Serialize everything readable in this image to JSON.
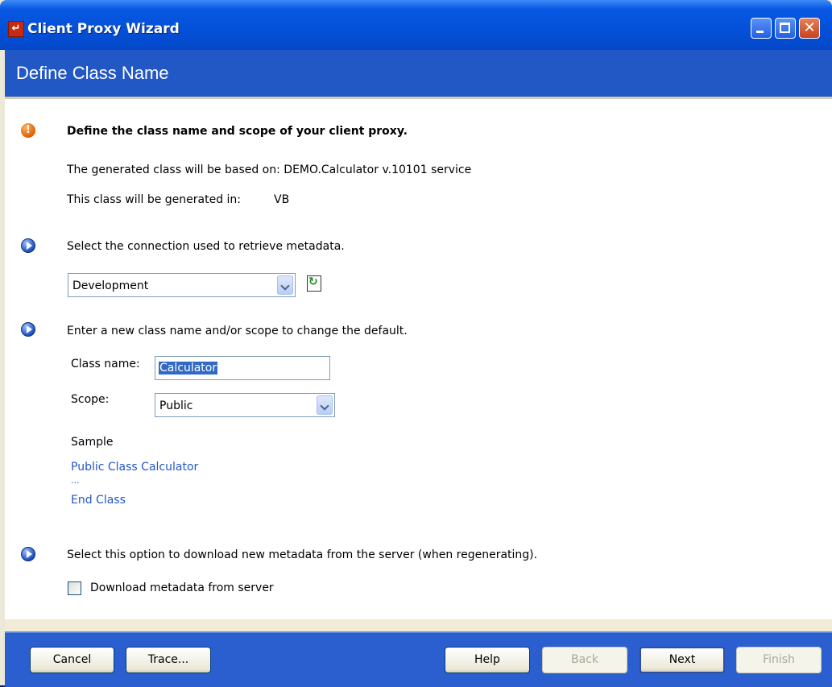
{
  "window": {
    "title": "Client Proxy Wizard",
    "icon": "wizard-app-icon"
  },
  "header": {
    "title": "Define Class Name"
  },
  "intro": {
    "heading": "Define the class name and scope of your client proxy.",
    "based_on": "The generated class will be based on: DEMO.Calculator v.10101 service",
    "generated_in": "This class will be generated in:",
    "language": "VB"
  },
  "connection": {
    "instruction": "Select the connection used to retrieve metadata.",
    "selected": "Development"
  },
  "class": {
    "instruction": "Enter a new class name and/or scope to change the default.",
    "name_label": "Class name:",
    "name_value": "Calculator",
    "scope_label": "Scope:",
    "scope_value": "Public"
  },
  "sample": {
    "label": "Sample",
    "line1": "Public Class Calculator",
    "line2": "...",
    "line3": "End Class"
  },
  "download": {
    "instruction": "Select this option to download new metadata from the server (when regenerating).",
    "checkbox_label": "Download metadata from server",
    "checked": false
  },
  "footer": {
    "cancel": "Cancel",
    "trace": "Trace...",
    "help": "Help",
    "back": "Back",
    "next": "Next",
    "finish": "Finish"
  },
  "colors": {
    "titlebar": "#0450d8",
    "header": "#2257c6",
    "link": "#2255cc",
    "footer": "#2b5fcf"
  }
}
